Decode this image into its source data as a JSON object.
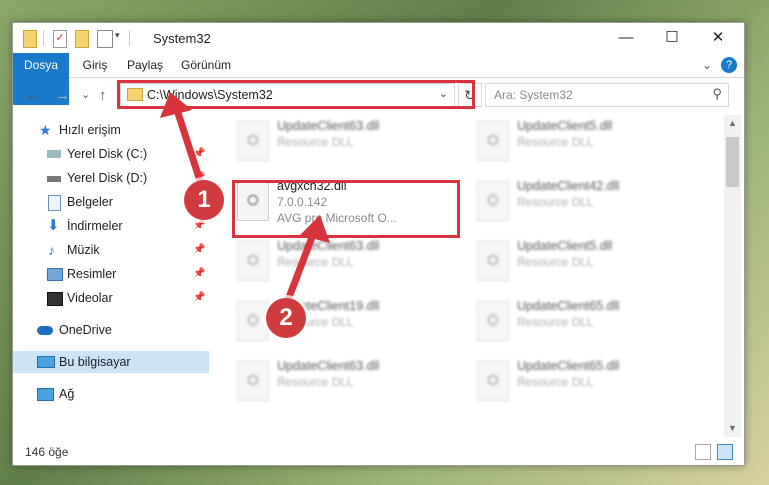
{
  "window": {
    "title": "System32",
    "controls": {
      "minimize": "—",
      "maximize": "☐",
      "close": "✕"
    }
  },
  "ribbon": {
    "tabs": [
      "Dosya",
      "Giriş",
      "Paylaş",
      "Görünüm"
    ],
    "expand_icon": "chevron-down",
    "help_icon": "?"
  },
  "address": {
    "path": "C:\\Windows\\System32",
    "search_placeholder": "Ara: System32"
  },
  "nav": {
    "back": "←",
    "forward": "→",
    "recent": "⌄",
    "up": "↑",
    "refresh": "↻"
  },
  "sidebar": {
    "items": [
      {
        "label": "Hızlı erişim",
        "icon": "star-icon",
        "color": "#2b79d4"
      },
      {
        "label": "Yerel Disk (C:)",
        "icon": "drive-icon",
        "pinned": true
      },
      {
        "label": "Yerel Disk (D:)",
        "icon": "drive-icon",
        "pinned": true
      },
      {
        "label": "Belgeler",
        "icon": "document-icon",
        "pinned": true
      },
      {
        "label": "İndirmeler",
        "icon": "download-icon",
        "pinned": true
      },
      {
        "label": "Müzik",
        "icon": "music-icon",
        "pinned": true
      },
      {
        "label": "Resimler",
        "icon": "pictures-icon",
        "pinned": true
      },
      {
        "label": "Videolar",
        "icon": "video-icon",
        "pinned": true
      },
      {
        "label": "OneDrive",
        "icon": "cloud-icon"
      },
      {
        "label": "Bu bilgisayar",
        "icon": "computer-icon",
        "selected": true
      },
      {
        "label": "Ağ",
        "icon": "network-icon"
      }
    ]
  },
  "files": {
    "highlighted": {
      "name": "avgxch32.dll",
      "version": "7.0.0.142",
      "description": "AVG pro Microsoft O..."
    },
    "blurred": [
      {
        "name": "UpdateClient63.dll",
        "type": "Resource DLL"
      },
      {
        "name": "UpdateClient5.dll",
        "type": "Resource DLL"
      },
      {
        "name": "UpdateClient42.dll",
        "type": "Resource DLL"
      },
      {
        "name": "UpdateClient63.dll",
        "type": "Resource DLL"
      },
      {
        "name": "UpdateClient5.dll",
        "type": "Resource DLL"
      },
      {
        "name": "UpdateClient19.dll",
        "type": "Resource DLL"
      },
      {
        "name": "UpdateClient65.dll",
        "type": "Resource DLL"
      },
      {
        "name": "UpdateClient63.dll",
        "type": "Resource DLL"
      },
      {
        "name": "UpdateClient65.dll",
        "type": "Resource DLL"
      }
    ]
  },
  "status": {
    "count": "146 öğe"
  },
  "annotations": {
    "step1": "1",
    "step2": "2",
    "color": "#d9343b"
  }
}
